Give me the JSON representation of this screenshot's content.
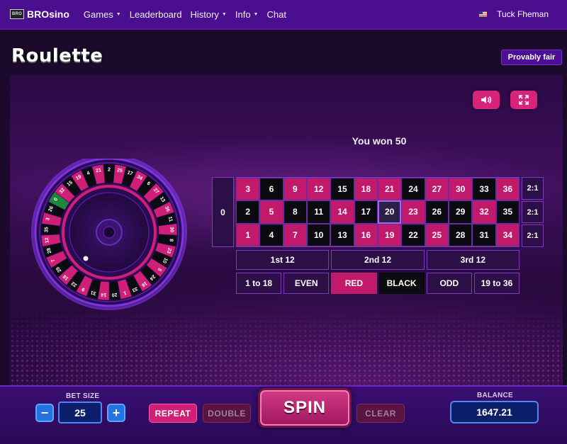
{
  "navbar": {
    "logo_box": "BRO",
    "logo_text": "BROsino",
    "items": [
      {
        "label": "Games",
        "dropdown": true
      },
      {
        "label": "Leaderboard",
        "dropdown": false
      },
      {
        "label": "History",
        "dropdown": true
      },
      {
        "label": "Info",
        "dropdown": true
      },
      {
        "label": "Chat",
        "dropdown": false
      }
    ],
    "user": "Tuck Fheman",
    "flag_icon": "us-flag-icon"
  },
  "page": {
    "title": "Roulette",
    "provably_fair": "Provably fair"
  },
  "game": {
    "result_message": "You won 50",
    "sound_icon": "speaker-icon",
    "fullscreen_icon": "expand-icon"
  },
  "wheel": {
    "numbers": [
      "0",
      "32",
      "15",
      "19",
      "4",
      "21",
      "2",
      "25",
      "17",
      "34",
      "6",
      "27",
      "13",
      "36",
      "11",
      "30",
      "8",
      "23",
      "10",
      "5",
      "24",
      "16",
      "33",
      "1",
      "20",
      "14",
      "31",
      "9",
      "22",
      "18",
      "29",
      "7",
      "28",
      "12",
      "35",
      "3",
      "26"
    ]
  },
  "table": {
    "zero": "0",
    "rows": [
      [
        {
          "n": "3",
          "c": "red"
        },
        {
          "n": "6",
          "c": "black"
        },
        {
          "n": "9",
          "c": "red"
        },
        {
          "n": "12",
          "c": "red"
        },
        {
          "n": "15",
          "c": "black"
        },
        {
          "n": "18",
          "c": "red"
        },
        {
          "n": "21",
          "c": "red"
        },
        {
          "n": "24",
          "c": "black"
        },
        {
          "n": "27",
          "c": "red"
        },
        {
          "n": "30",
          "c": "red"
        },
        {
          "n": "33",
          "c": "black"
        },
        {
          "n": "36",
          "c": "red"
        }
      ],
      [
        {
          "n": "2",
          "c": "black"
        },
        {
          "n": "5",
          "c": "red"
        },
        {
          "n": "8",
          "c": "black"
        },
        {
          "n": "11",
          "c": "black"
        },
        {
          "n": "14",
          "c": "red"
        },
        {
          "n": "17",
          "c": "black"
        },
        {
          "n": "20",
          "c": "black",
          "selected": true
        },
        {
          "n": "23",
          "c": "red"
        },
        {
          "n": "26",
          "c": "black"
        },
        {
          "n": "29",
          "c": "black"
        },
        {
          "n": "32",
          "c": "red"
        },
        {
          "n": "35",
          "c": "black"
        }
      ],
      [
        {
          "n": "1",
          "c": "red"
        },
        {
          "n": "4",
          "c": "black"
        },
        {
          "n": "7",
          "c": "red"
        },
        {
          "n": "10",
          "c": "black"
        },
        {
          "n": "13",
          "c": "black"
        },
        {
          "n": "16",
          "c": "red"
        },
        {
          "n": "19",
          "c": "red"
        },
        {
          "n": "22",
          "c": "black"
        },
        {
          "n": "25",
          "c": "red"
        },
        {
          "n": "28",
          "c": "black"
        },
        {
          "n": "31",
          "c": "black"
        },
        {
          "n": "34",
          "c": "red"
        }
      ]
    ],
    "column_bets": [
      "2:1",
      "2:1",
      "2:1"
    ],
    "dozens": [
      "1st 12",
      "2nd 12",
      "3rd 12"
    ],
    "outside": [
      {
        "label": "1 to 18",
        "style": ""
      },
      {
        "label": "EVEN",
        "style": ""
      },
      {
        "label": "RED",
        "style": "red"
      },
      {
        "label": "BLACK",
        "style": "black"
      },
      {
        "label": "ODD",
        "style": ""
      },
      {
        "label": "19 to 36",
        "style": ""
      }
    ]
  },
  "controls": {
    "bet_size_label": "BET SIZE",
    "bet_value": "25",
    "minus": "−",
    "plus": "+",
    "repeat": "REPEAT",
    "double": "DOUBLE",
    "spin": "SPIN",
    "clear": "CLEAR",
    "balance_label": "BALANCE",
    "balance_value": "1647.21"
  },
  "colors": {
    "nav_bg": "#4a0e8f",
    "red": "#c21a6a",
    "black": "#0a0a10",
    "accent_blue": "#2573e0"
  }
}
